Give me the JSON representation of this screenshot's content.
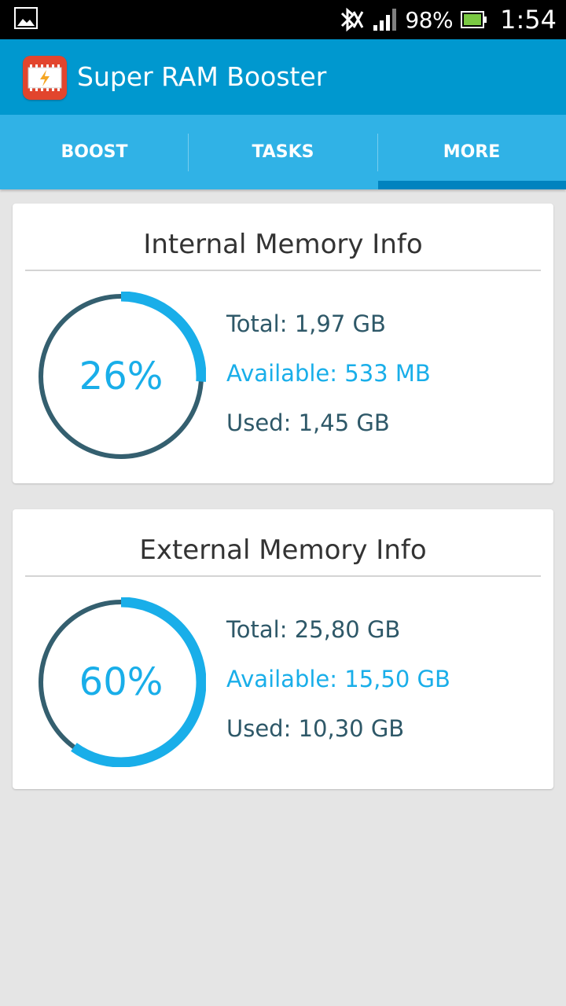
{
  "status_bar": {
    "battery_percent": "98%",
    "time": "1:54",
    "icons": [
      "gallery-icon",
      "bluetooth-off-icon",
      "signal-icon",
      "battery-icon"
    ]
  },
  "app": {
    "title": "Super RAM Booster",
    "icon": "ram-chip-icon"
  },
  "tabs": [
    {
      "label": "BOOST",
      "selected": false
    },
    {
      "label": "TASKS",
      "selected": false
    },
    {
      "label": "MORE",
      "selected": true
    }
  ],
  "internal": {
    "title": "Internal Memory Info",
    "percent_label": "26%",
    "percent_value": 26,
    "total": "Total: 1,97 GB",
    "available": "Available: 533 MB",
    "used": "Used: 1,45 GB"
  },
  "external": {
    "title": "External Memory Info",
    "percent_label": "60%",
    "percent_value": 60,
    "total": "Total: 25,80 GB",
    "available": "Available: 15,50 GB",
    "used": "Used: 10,30 GB"
  },
  "colors": {
    "app_bar": "#0098cf",
    "tab_bar": "#30b2e6",
    "accent": "#19aee9",
    "ring_track": "#345f6f",
    "card_text": "#2e5868"
  }
}
